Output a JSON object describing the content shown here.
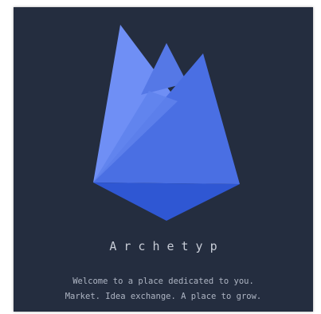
{
  "app": {
    "brand_name": "Archetyp",
    "tagline_line1": "Welcome to a place dedicated to you.",
    "tagline_line2": "Market. Idea exchange. A place to grow."
  },
  "logo": {
    "icon": "flame-crystal-logo",
    "colors": {
      "light": "#6f8ff5",
      "mid": "#5a7fe9",
      "main": "#4a6fe3",
      "dark": "#3d63d8",
      "deep": "#2f55cf"
    }
  },
  "theme": {
    "background": "#242d3f",
    "text": "#c7ccd6"
  }
}
